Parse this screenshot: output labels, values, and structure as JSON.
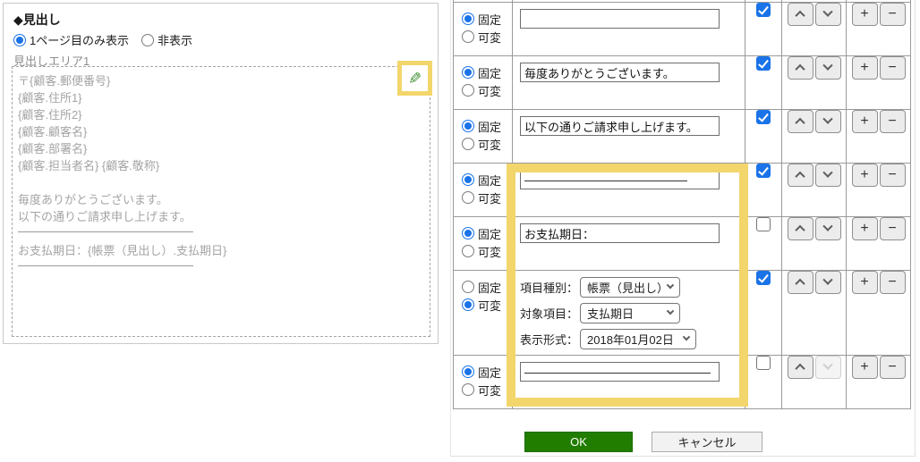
{
  "colors": {
    "accent_blue": "#1a73e8",
    "ok_green": "#217d00",
    "highlight_yellow": "#f3d66b",
    "pencil_green": "#3f8f2f"
  },
  "left_panel": {
    "title": "◆見出し",
    "display_options": [
      {
        "label": "1ページ目のみ表示",
        "selected": true
      },
      {
        "label": "非表示",
        "selected": false
      }
    ],
    "area_label": "見出しエリア1",
    "edit_icon": "pencil-icon",
    "preview_lines": [
      {
        "type": "text",
        "value": "〒{顧客.郵便番号}"
      },
      {
        "type": "text",
        "value": "{顧客.住所1}"
      },
      {
        "type": "text",
        "value": "{顧客.住所2}"
      },
      {
        "type": "text",
        "value": "{顧客.顧客名}"
      },
      {
        "type": "text",
        "value": "{顧客.部署名}"
      },
      {
        "type": "text",
        "value": "{顧客.担当者名} {顧客.敬称}"
      },
      {
        "type": "blank"
      },
      {
        "type": "text",
        "value": "毎度ありがとうございます。"
      },
      {
        "type": "text",
        "value": "以下の通りご請求申し上げます。"
      },
      {
        "type": "rule"
      },
      {
        "type": "text",
        "value": "お支払期日：{帳票（見出し）.支払期日}"
      },
      {
        "type": "rule"
      }
    ]
  },
  "table": {
    "mode_labels": {
      "fixed": "固定",
      "variable": "可変"
    },
    "rows": [
      {
        "mode": "fixed",
        "text": "",
        "checked": true,
        "up_enabled": true,
        "down_enabled": true
      },
      {
        "mode": "fixed",
        "text": "毎度ありがとうございます。",
        "checked": true,
        "up_enabled": true,
        "down_enabled": true
      },
      {
        "mode": "fixed",
        "text": "以下の通りご請求申し上げます。",
        "checked": true,
        "up_enabled": true,
        "down_enabled": true
      },
      {
        "mode": "fixed",
        "text": "――――――――――――――",
        "checked": true,
        "up_enabled": true,
        "down_enabled": true
      },
      {
        "mode": "fixed",
        "text": "お支払期日：",
        "checked": false,
        "up_enabled": true,
        "down_enabled": true
      },
      {
        "mode": "variable",
        "checked": true,
        "up_enabled": true,
        "down_enabled": true,
        "selects": [
          {
            "name": "item-type-select",
            "label": "項目種別：",
            "value": "帳票（見出し）"
          },
          {
            "name": "target-field-select",
            "label": "対象項目：",
            "value": "支払期日"
          },
          {
            "name": "display-format-select",
            "label": "表示形式：",
            "value": "2018年01月02日"
          }
        ]
      },
      {
        "mode": "fixed",
        "text": "――――――――――――――――",
        "checked": false,
        "up_enabled": true,
        "down_enabled": false
      }
    ]
  },
  "footer": {
    "ok_label": "OK",
    "cancel_label": "キャンセル"
  }
}
